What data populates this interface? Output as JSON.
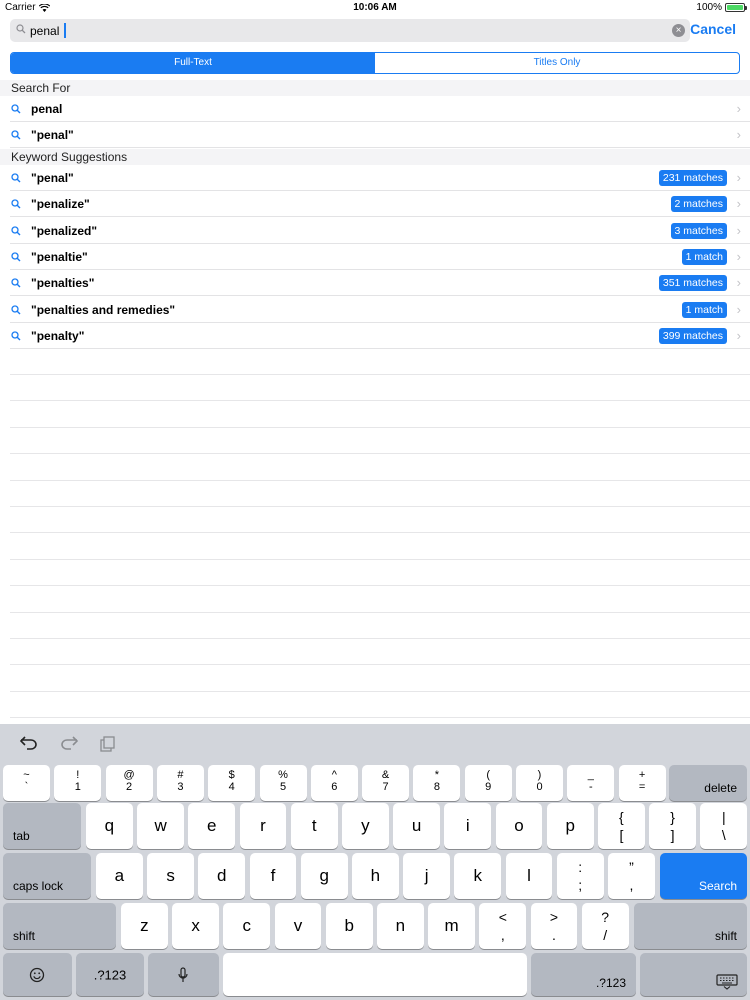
{
  "status_bar": {
    "carrier": "Carrier",
    "time": "10:06 AM",
    "battery": "100%",
    "colors": {
      "battery": "#4cd964"
    }
  },
  "search": {
    "query": "penal",
    "cancel_label": "Cancel"
  },
  "segments": [
    {
      "label": "Full-Text",
      "active": true
    },
    {
      "label": "Titles Only",
      "active": false
    }
  ],
  "search_for": {
    "header": "Search For",
    "items": [
      {
        "label": "penal"
      },
      {
        "label": "\"penal\""
      }
    ]
  },
  "keyword_suggestions": {
    "header": "Keyword Suggestions",
    "items": [
      {
        "label": "\"penal\"",
        "badge": "231 matches"
      },
      {
        "label": "\"penalize\"",
        "badge": "2 matches"
      },
      {
        "label": "\"penalized\"",
        "badge": "3 matches"
      },
      {
        "label": "\"penaltie\"",
        "badge": "1 match"
      },
      {
        "label": "\"penalties\"",
        "badge": "351 matches"
      },
      {
        "label": "\"penalties and remedies\"",
        "badge": "1 match"
      },
      {
        "label": "\"penalty\"",
        "badge": "399 matches"
      }
    ]
  },
  "keyboard": {
    "toolbar": {
      "undo": "undo-icon",
      "redo": "redo-icon",
      "paste": "paste-icon"
    },
    "row1": [
      {
        "top": "~",
        "bot": "`"
      },
      {
        "top": "!",
        "bot": "1"
      },
      {
        "top": "@",
        "bot": "2"
      },
      {
        "top": "#",
        "bot": "3"
      },
      {
        "top": "$",
        "bot": "4"
      },
      {
        "top": "%",
        "bot": "5"
      },
      {
        "top": "^",
        "bot": "6"
      },
      {
        "top": "&",
        "bot": "7"
      },
      {
        "top": "*",
        "bot": "8"
      },
      {
        "top": "(",
        "bot": "9"
      },
      {
        "top": ")",
        "bot": "0"
      },
      {
        "top": "_",
        "bot": "-"
      },
      {
        "top": "+",
        "bot": "="
      }
    ],
    "delete": "delete",
    "tab": "tab",
    "row2": [
      "q",
      "w",
      "e",
      "r",
      "t",
      "y",
      "u",
      "i",
      "o",
      "p"
    ],
    "row2_sym": [
      {
        "top": "{",
        "bot": "["
      },
      {
        "top": "}",
        "bot": "]"
      },
      {
        "top": "|",
        "bot": "\\"
      }
    ],
    "caps_lock": "caps lock",
    "row3": [
      "a",
      "s",
      "d",
      "f",
      "g",
      "h",
      "j",
      "k",
      "l"
    ],
    "row3_sym": [
      {
        "top": ":",
        "bot": ";"
      },
      {
        "top": "”",
        "bot": ","
      }
    ],
    "search": "Search",
    "shift": "shift",
    "row4": [
      "z",
      "x",
      "c",
      "v",
      "b",
      "n",
      "m"
    ],
    "row4_sym": [
      {
        "top": "<",
        "bot": ","
      },
      {
        "top": ">",
        "bot": "."
      },
      {
        "top": "?",
        "bot": "/"
      }
    ],
    "numbers_label": ".?123"
  }
}
